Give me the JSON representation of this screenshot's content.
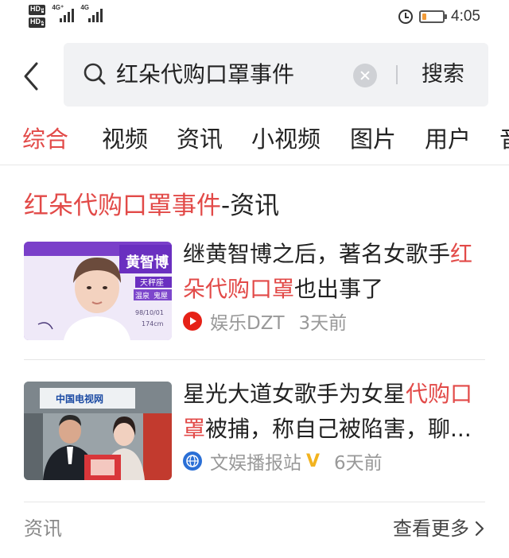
{
  "status_bar": {
    "sim1_label": "HD",
    "sim1_index": "1",
    "sim2_label": "HD",
    "sim2_index": "2",
    "net1_label": "4G⁺",
    "net2_label": "4G",
    "battery_level": 0.2,
    "battery_color": "#f29b38",
    "time": "4:05"
  },
  "search": {
    "query": "红朵代购口罩事件",
    "button_label": "搜索"
  },
  "tabs": [
    {
      "label": "综合",
      "active": true
    },
    {
      "label": "视频",
      "active": false
    },
    {
      "label": "资讯",
      "active": false
    },
    {
      "label": "小视频",
      "active": false
    },
    {
      "label": "图片",
      "active": false
    },
    {
      "label": "用户",
      "active": false
    },
    {
      "label": "音",
      "active": false
    }
  ],
  "section": {
    "title_highlight": "红朵代购口罩事件",
    "title_suffix": "-资讯"
  },
  "news": [
    {
      "title_pre": "继黄智博之后，著名女歌手",
      "title_highlight": "红朵代购口罩",
      "title_post": "也出事了",
      "source": "娱乐DZT",
      "time_ago": "3天前",
      "source_icon": "youtube-play-icon",
      "thumb_text_1": "黄智博",
      "thumb_text_2": "天秤座",
      "thumb_text_3": "温泉",
      "thumb_text_4": "鬼屋",
      "thumb_text_5": "98/10/01",
      "thumb_text_6": "174cm"
    },
    {
      "title_pre": "星光大道女歌手为女星",
      "title_highlight": "代购口罩",
      "title_post": "被捕，称自己被陷害，聊...",
      "source": "文娱播报站",
      "verified": "V",
      "time_ago": "6天前",
      "source_icon": "globe-logo-icon",
      "thumb_text_1": "中国电视网"
    }
  ],
  "footer": {
    "category": "资讯",
    "more_label": "查看更多"
  },
  "colors": {
    "accent": "#e24a48",
    "meta_gray": "#999999",
    "search_bg": "#f1f2f4"
  }
}
